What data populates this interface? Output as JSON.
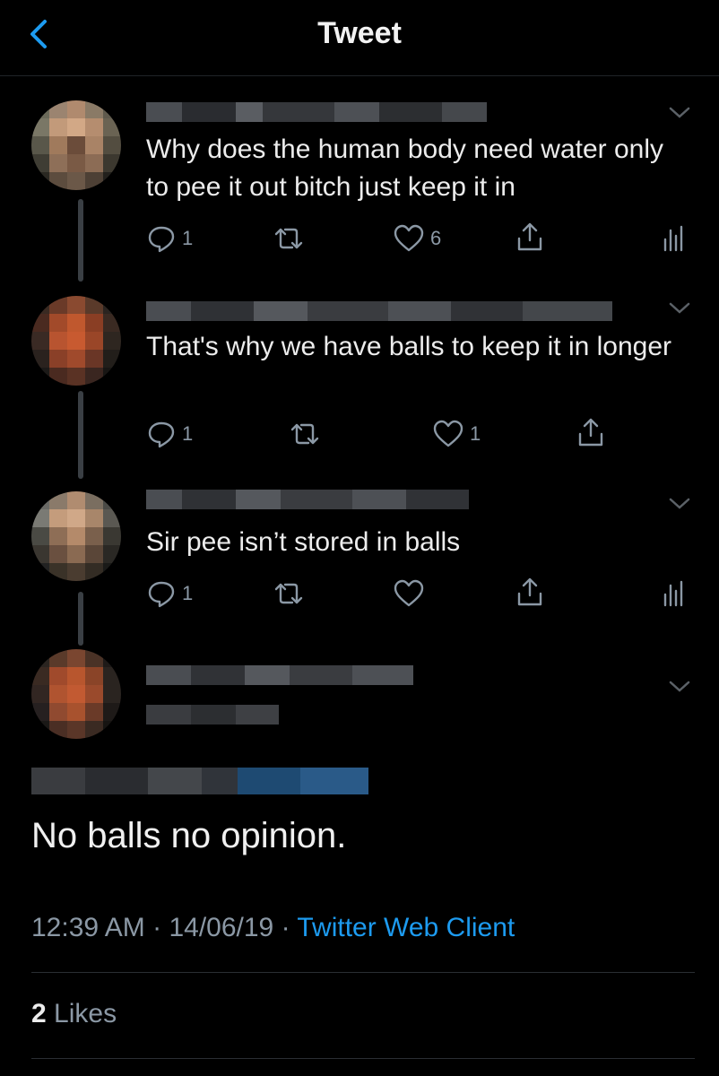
{
  "header": {
    "title": "Tweet"
  },
  "replies": [
    {
      "text": "Why does the human body need water only to pee it out bitch just keep it in",
      "reply_count": "1",
      "like_count": "6"
    },
    {
      "text": "That's why we have balls to keep it in longer",
      "reply_count": "1",
      "like_count": "1"
    },
    {
      "text": "Sir pee isn’t stored in balls",
      "reply_count": "1",
      "like_count": ""
    }
  ],
  "main_tweet": {
    "text": "No balls no opinion.",
    "time": "12:39 AM",
    "date": "14/06/19",
    "separator": "·",
    "client": "Twitter Web Client",
    "likes_count": "2",
    "likes_label": "Likes"
  },
  "colors": {
    "accent": "#1d9bf0",
    "muted": "#8b98a5",
    "background": "#000000"
  }
}
